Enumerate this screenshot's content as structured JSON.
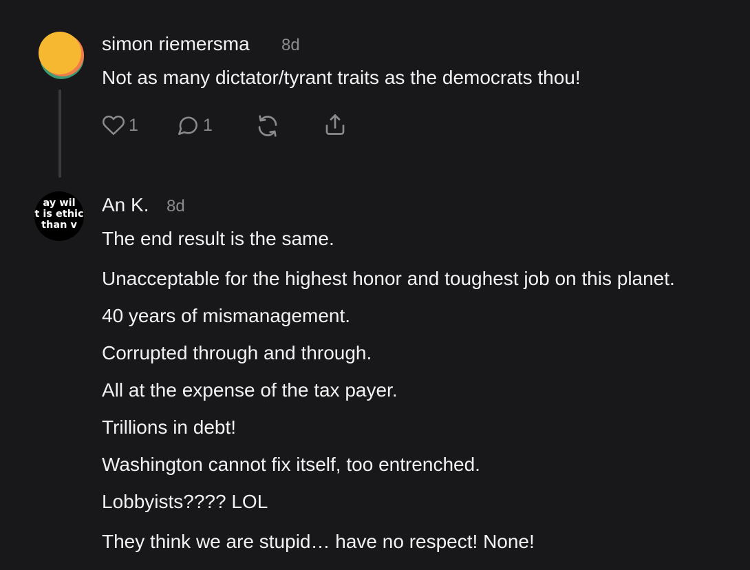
{
  "comments": [
    {
      "author": "simon riemersma",
      "time": "8d",
      "avatar_colors": [
        "#f6b731",
        "#f07c4a",
        "#3d9a72"
      ],
      "lines": [
        "Not as many dictator/tyrant traits as the democrats thou!"
      ],
      "actions": {
        "like_icon": "heart-icon",
        "like_count": "1",
        "reply_icon": "comment-icon",
        "reply_count": "1",
        "restack_icon": "restack-icon",
        "share_icon": "share-icon"
      }
    },
    {
      "author": "An K.",
      "time": "8d",
      "avatar_text": [
        "ay wil",
        "t is ethic",
        "than v"
      ],
      "lines": [
        "The end result is the same.",
        "Unacceptable for the highest honor and toughest job on this planet.",
        "40 years of mismanagement.",
        "Corrupted through and through.",
        "All at the expense of the tax payer.",
        "Trillions in debt!",
        "Washington cannot fix itself, too entrenched.",
        "Lobbyists???? LOL",
        "They think we are stupid… have no respect! None!"
      ]
    }
  ],
  "colors": {
    "background": "#18181a",
    "text": "#f2f2f2",
    "muted": "#8b8b8e",
    "thread_line": "#3a3a3d"
  }
}
